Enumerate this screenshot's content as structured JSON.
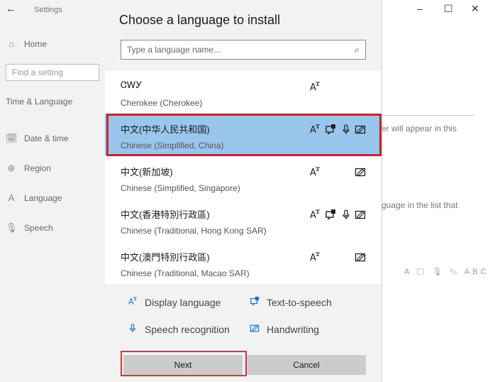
{
  "settings": {
    "back_icon": "←",
    "title": "Settings",
    "nav": [
      {
        "icon": "⌂",
        "label": "Home"
      },
      {
        "icon": "🗓",
        "label": "Date & time"
      },
      {
        "icon": "⊕",
        "label": "Region"
      },
      {
        "icon": "A",
        "label": "Language"
      },
      {
        "icon": "🎙",
        "label": "Speech"
      }
    ],
    "find_placeholder": "Find a setting",
    "section": "Time & Language",
    "bg_text_1": "er will appear in this",
    "bg_text_2": "guage in the list that",
    "bg_icons": "A 🖵 🎙 ✎ ABC",
    "minimize": "–",
    "maximize": "☐",
    "close": "✕"
  },
  "dialog": {
    "title": "Choose a language to install",
    "search_placeholder": "Type a language name...",
    "search_icon": "⌕",
    "languages": [
      {
        "name": "ᏣᎳᎩ",
        "sub": "Cherokee (Cherokee)",
        "features": [
          "display-language"
        ]
      },
      {
        "name": "中文(中华人民共和国)",
        "sub": "Chinese (Simplified, China)",
        "features": [
          "display-language",
          "text-to-speech",
          "speech-recognition",
          "handwriting"
        ],
        "selected": true
      },
      {
        "name": "中文(新加坡)",
        "sub": "Chinese (Simplified, Singapore)",
        "features": [
          "display-language",
          "handwriting"
        ]
      },
      {
        "name": "中文(香港特別行政區)",
        "sub": "Chinese (Traditional, Hong Kong SAR)",
        "features": [
          "display-language",
          "text-to-speech",
          "speech-recognition",
          "handwriting"
        ]
      },
      {
        "name": "中文(澳門特別行政區)",
        "sub": "Chinese (Traditional, Macao SAR)",
        "features": [
          "display-language",
          "handwriting"
        ]
      }
    ],
    "legend": {
      "display_language": "Display language",
      "text_to_speech": "Text-to-speech",
      "speech_recognition": "Speech recognition",
      "handwriting": "Handwriting"
    },
    "next_label": "Next",
    "cancel_label": "Cancel"
  },
  "colors": {
    "selection": "#99c6ec",
    "highlight": "#c0272d",
    "icon_accent": "#1a73c9"
  }
}
